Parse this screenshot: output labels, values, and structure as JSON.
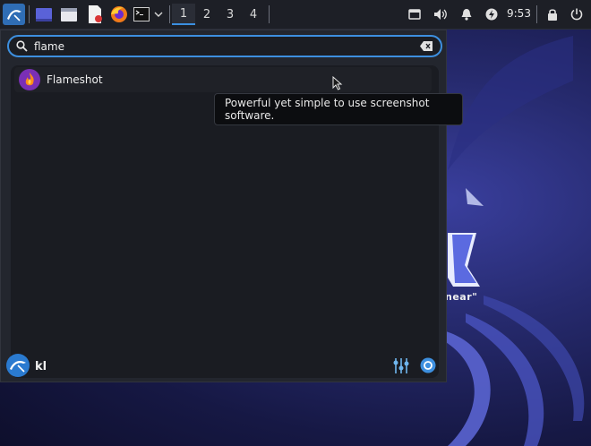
{
  "taskbar": {
    "launchers": [
      {
        "icon": "kali-menu-icon"
      },
      {
        "icon": "show-desktop-icon"
      },
      {
        "icon": "file-manager-icon"
      },
      {
        "icon": "text-editor-icon"
      },
      {
        "icon": "firefox-icon"
      },
      {
        "icon": "terminal-icon"
      },
      {
        "icon": "terminal-dropdown-chevron-icon"
      }
    ],
    "workspaces": [
      "1",
      "2",
      "3",
      "4"
    ],
    "active_workspace": "1",
    "tray": [
      {
        "icon": "display-icon"
      },
      {
        "icon": "volume-icon"
      },
      {
        "icon": "notification-bell-icon"
      },
      {
        "icon": "power-manager-icon"
      }
    ],
    "clock": "9:53",
    "lock_icon": "lock-icon",
    "logout_icon": "logout-icon"
  },
  "menu": {
    "search": {
      "value": "flame",
      "search_icon": "search-icon",
      "clear_icon": "clear-text-icon"
    },
    "results": [
      {
        "label": "Flameshot",
        "icon": "flameshot-icon"
      }
    ],
    "tooltip": "Powerful yet simple to use screenshot software.",
    "user": {
      "name": "kl",
      "avatar_icon": "kali-avatar-icon"
    },
    "footer_icons": [
      "settings-manager-icon",
      "switch-user-icon"
    ]
  },
  "wallpaper": {
    "visible_text": "near\""
  },
  "colors": {
    "accent": "#3d8fdf",
    "panel": "#1d1f26",
    "menu_bg": "#23262e"
  }
}
